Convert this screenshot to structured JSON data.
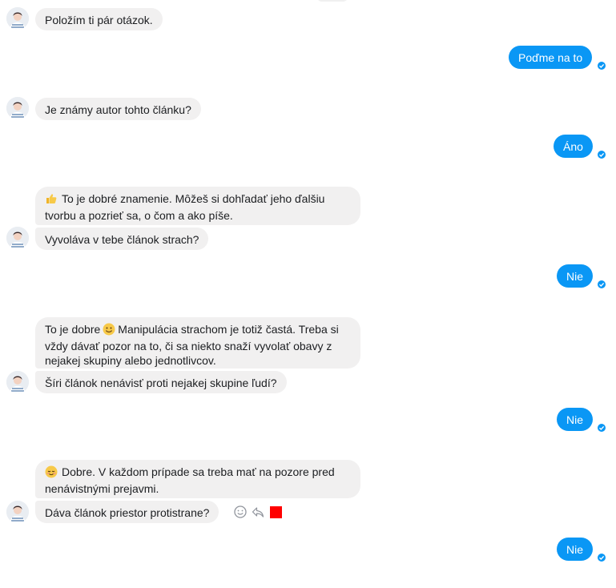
{
  "messages": {
    "m1": "Položím ti pár otázok.",
    "r1": "Poďme na to",
    "m2": "Je známy autor tohto článku?",
    "r2": "Áno",
    "m3a": "To je dobré znamenie. Môžeš si dohľadať jeho ďalšiu tvorbu a pozrieť sa, o čom a ako píše.",
    "m3b": "Vyvoláva v tebe článok strach?",
    "r3": "Nie",
    "m4a_1": "To je dobre",
    "m4a_2": "Manipulácia strachom je totiž častá. Treba si vždy dávať pozor na to, či sa niekto snaží vyvolať obavy z nejakej skupiny alebo jednotlivcov.",
    "m4b": "Šíri článok nenávisť proti nejakej skupine ľudí?",
    "r4": "Nie",
    "m5a": "Dobre. V každom prípade sa treba mať na pozore pred nenávistnými prejavmi.",
    "m5b": "Dáva článok priestor protistrane?",
    "r5": "Nie"
  },
  "icons": {
    "avatar": "avatar-icon",
    "read_receipt": "check-circle-icon",
    "thumbs_up": "thumbs-up-emoji",
    "smile": "smile-emoji",
    "relieved": "relieved-emoji",
    "reaction": "smiley-reaction-icon",
    "reply": "reply-icon"
  },
  "colors": {
    "outgoing_bubble": "#0a97f5",
    "incoming_bubble": "#f1f0f0",
    "highlight_square": "#ff0000"
  }
}
